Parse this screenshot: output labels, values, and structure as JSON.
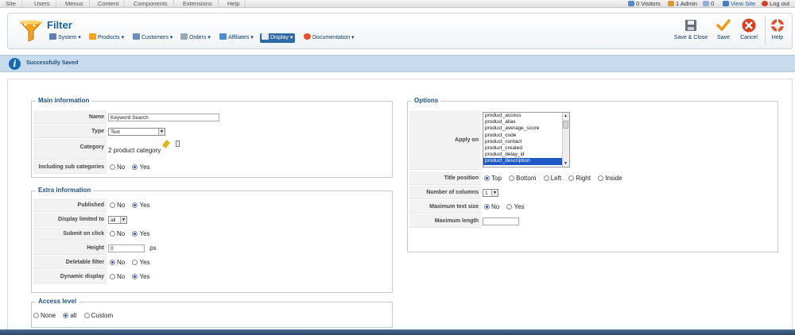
{
  "topmenu": [
    "Site",
    "Users",
    "Menus",
    "Content",
    "Components",
    "Extensions",
    "Help"
  ],
  "status": {
    "visitors": "0 Visitors",
    "admin": "1 Admin",
    "messages": "0",
    "view_site": "View Site",
    "logout": "Log out"
  },
  "toolbar": {
    "title": "Filter",
    "nav": [
      "System",
      "Products",
      "Customers",
      "Orders",
      "Affiliates",
      "Display",
      "Documentation"
    ],
    "active_nav": "Display",
    "save_close": "Save & Close",
    "save": "Save",
    "cancel": "Cancel",
    "help": "Help"
  },
  "message": "Successfully Saved",
  "main_info": {
    "legend": "Main information",
    "name_label": "Name",
    "name_value": "Keyword Search",
    "type_label": "Type",
    "type_value": "Text",
    "category_label": "Category",
    "category_value": "2 product category",
    "subcat_label": "Including sub categories",
    "no": "No",
    "yes": "Yes"
  },
  "extra_info": {
    "legend": "Extra information",
    "published": "Published",
    "display_limited": "Display limited to",
    "display_limited_value": "all",
    "submit_on_click": "Submit on click",
    "height": "Height",
    "height_value": "0",
    "height_unit": "px",
    "deletable": "Deletable filter",
    "dynamic": "Dynamic display",
    "no": "No",
    "yes": "Yes"
  },
  "access": {
    "legend": "Access level",
    "none": "None",
    "all": "all",
    "custom": "Custom"
  },
  "options": {
    "legend": "Options",
    "apply_on": "Apply on",
    "apply_list": [
      "product_access",
      "product_alias",
      "product_average_score",
      "product_code",
      "product_contact",
      "product_created",
      "product_delay_id",
      "product_description"
    ],
    "apply_selected": "product_description",
    "title_position": "Title position",
    "positions": [
      "Top",
      "Bottom",
      "Left",
      "Right",
      "Inside"
    ],
    "columns": "Number of columns",
    "columns_value": "1",
    "max_text": "Maximum text size",
    "no": "No",
    "yes": "Yes",
    "max_length": "Maximum length"
  },
  "colors": {
    "title_blue": "#1b63a8",
    "message_bg": "#c9dcee",
    "legend_blue": "#1d4f82",
    "selected_option": "#1f59c8"
  }
}
